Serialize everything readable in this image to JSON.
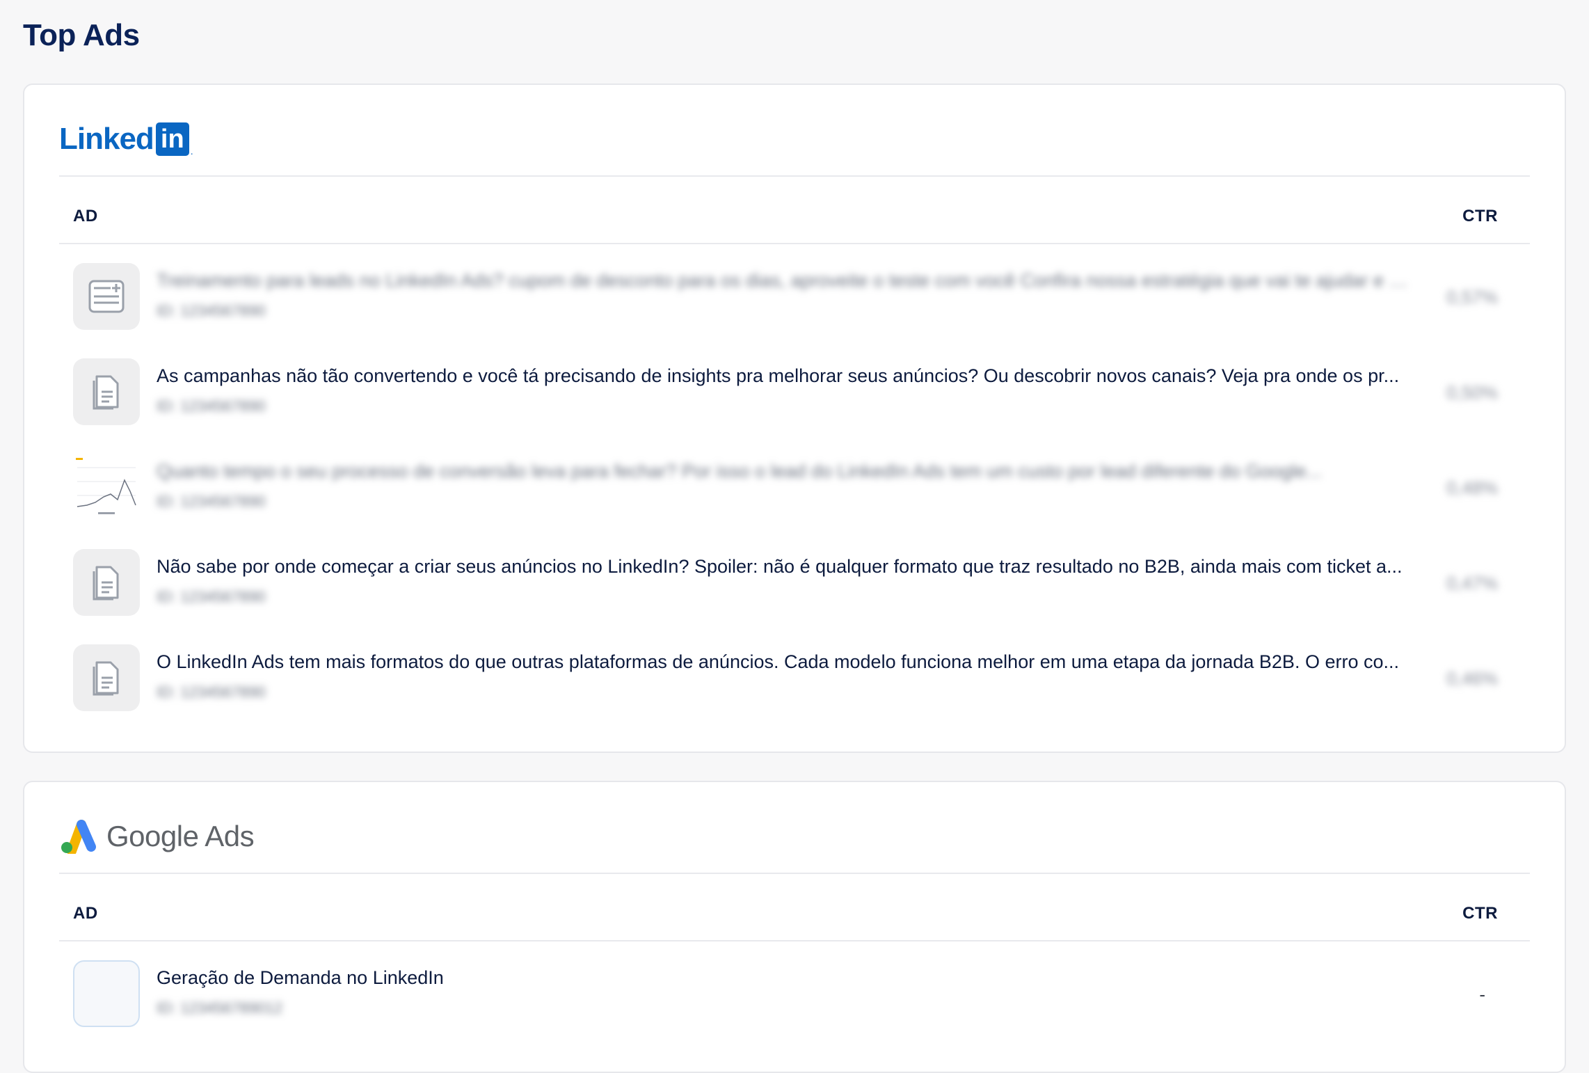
{
  "page_title": "Top Ads",
  "linkedin": {
    "logo_text": "Linked",
    "logo_box": "in",
    "logo_dot": ".",
    "col_ad": "AD",
    "col_ctr": "CTR",
    "rows": [
      {
        "thumb": "form-icon",
        "text": "Treinamento para leads no LinkedIn Ads? cupom de desconto para os dias, aproveite o teste com você Confira nossa estratégia que vai te ajudar e não perder mais...",
        "sub": "ID: 1234567890",
        "ctr": "0,57%",
        "blurred": true
      },
      {
        "thumb": "document-icon",
        "text": "As campanhas não tão convertendo e você tá precisando de insights pra melhorar seus anúncios? Ou descobrir novos canais? Veja pra onde os pr...",
        "sub": "ID: 1234567890",
        "ctr": "0,50%",
        "blurred": false
      },
      {
        "thumb": "chart-image",
        "text": "Quanto tempo o seu processo de conversão leva para fechar? Por isso o lead do LinkedIn Ads tem um custo por lead diferente do Google...",
        "sub": "ID: 1234567890",
        "ctr": "0,48%",
        "blurred": true
      },
      {
        "thumb": "document-icon",
        "text": "Não sabe por onde começar a criar seus anúncios no LinkedIn? Spoiler: não é qualquer formato que traz resultado no B2B, ainda mais com ticket a...",
        "sub": "ID: 1234567890",
        "ctr": "0,47%",
        "blurred": false
      },
      {
        "thumb": "document-icon",
        "text": "O LinkedIn Ads tem mais formatos do que outras plataformas de anúncios. Cada modelo funciona melhor em uma etapa da jornada B2B. O erro co...",
        "sub": "ID: 1234567890",
        "ctr": "0,46%",
        "blurred": false
      }
    ]
  },
  "google": {
    "logo_text": "Google Ads",
    "col_ad": "AD",
    "col_ctr": "CTR",
    "rows": [
      {
        "thumb": "empty",
        "text": "Geração de Demanda no LinkedIn",
        "sub": "ID: 123456789012",
        "ctr": "-"
      }
    ]
  }
}
